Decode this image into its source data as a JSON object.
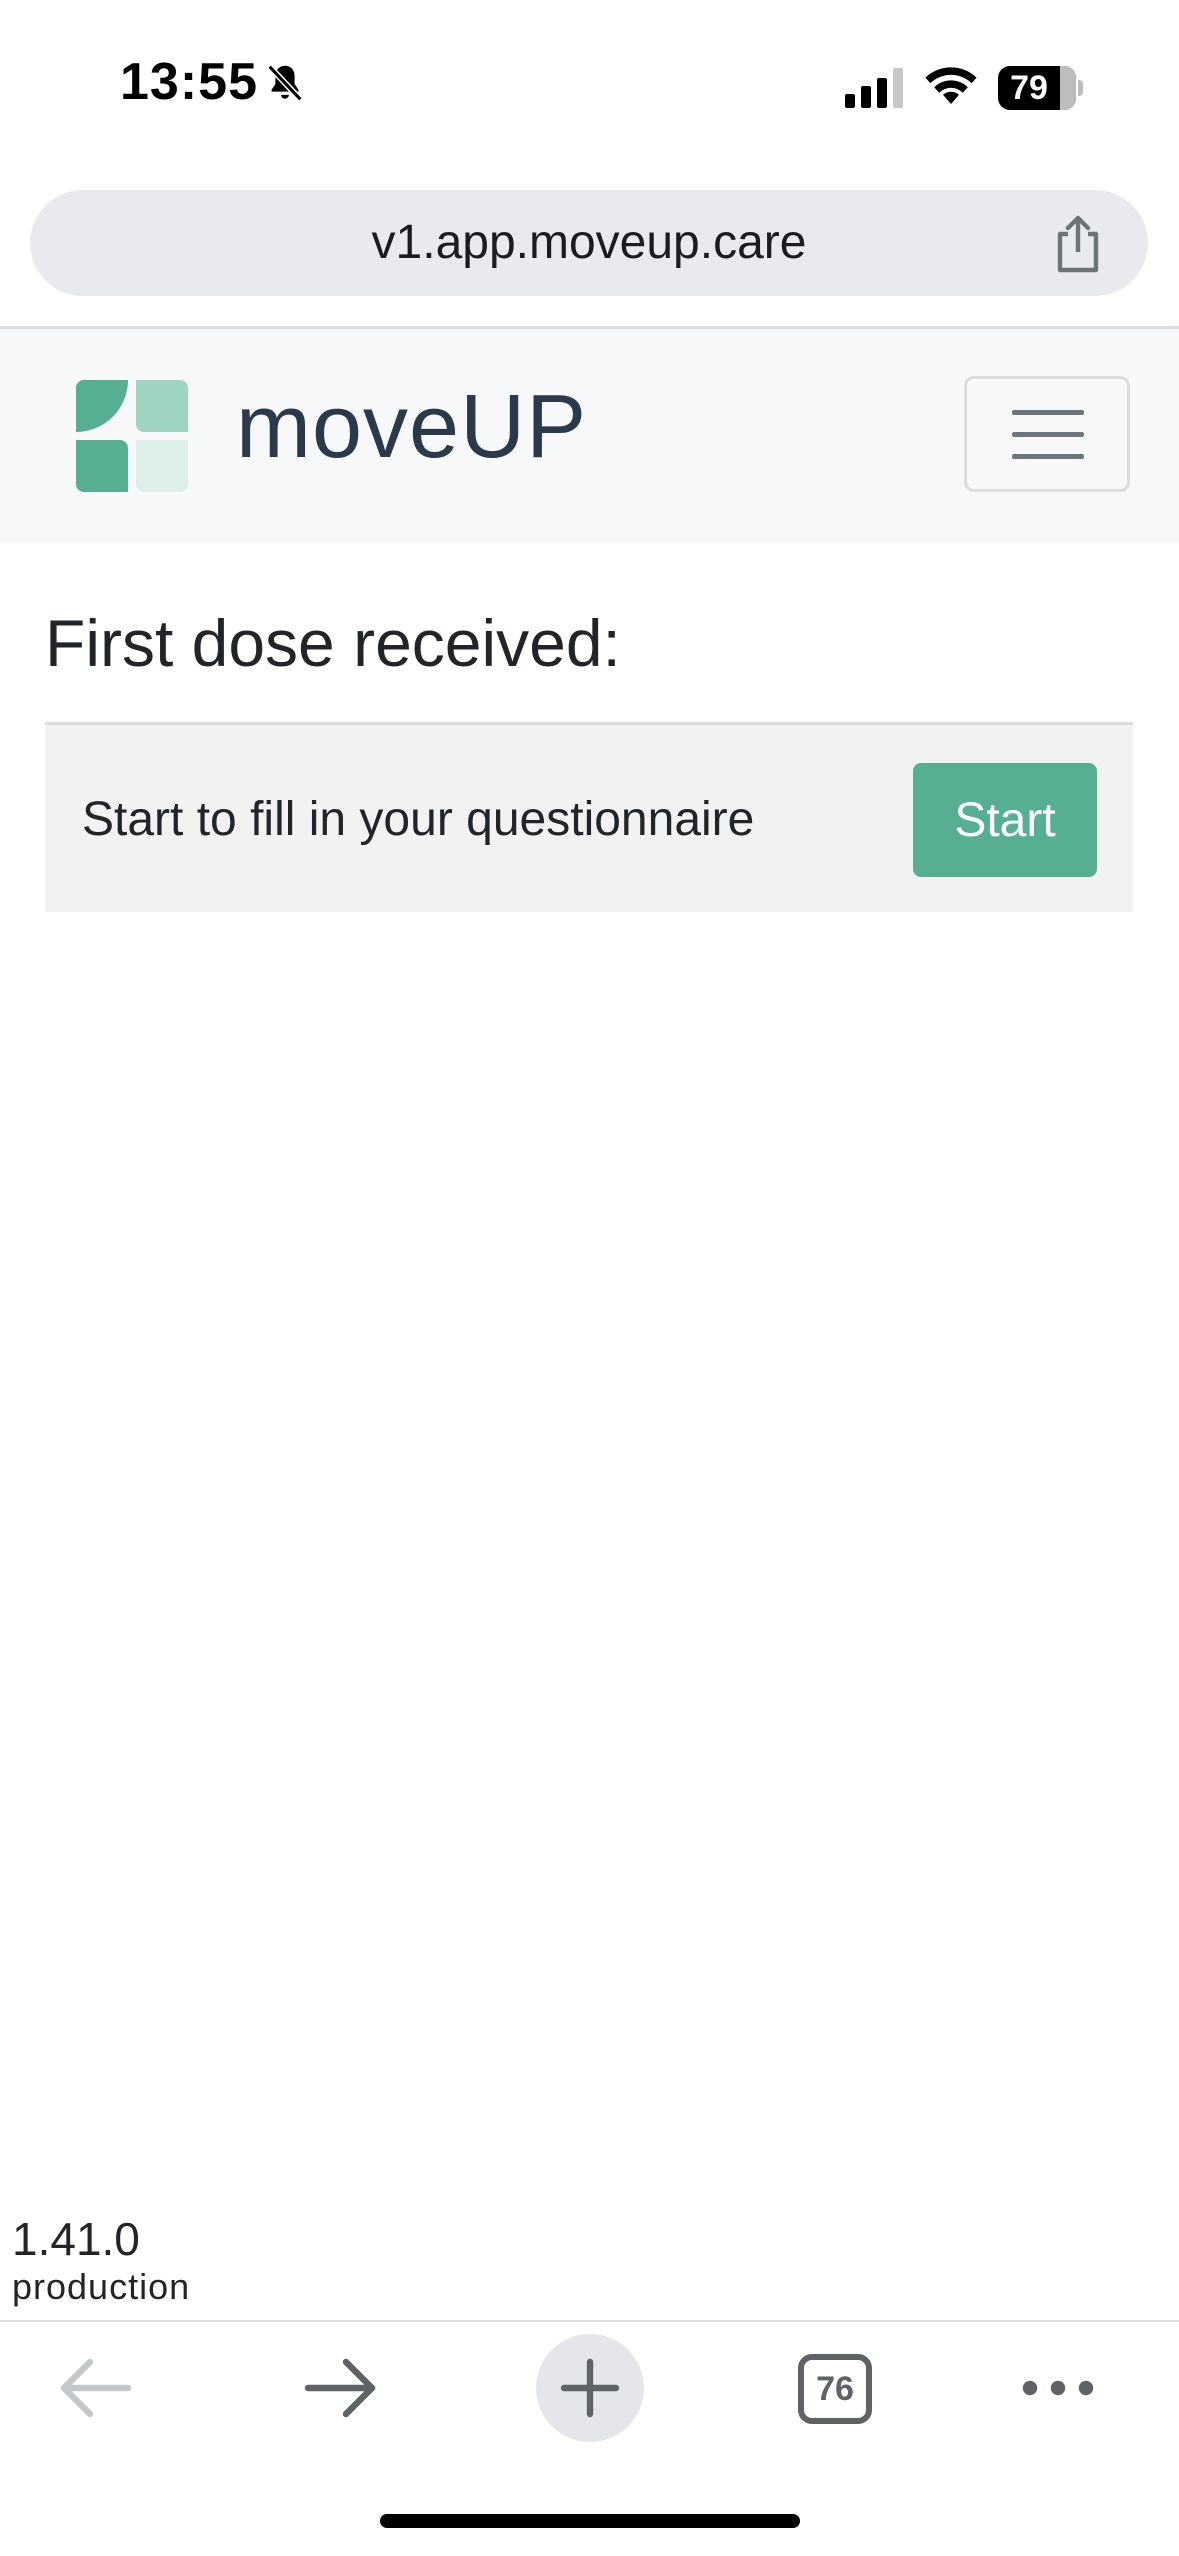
{
  "status_bar": {
    "time": "13:55",
    "battery_level": "79",
    "icons": [
      "bell-slash-icon",
      "cellular-signal-icon",
      "wifi-icon",
      "battery-icon"
    ]
  },
  "browser": {
    "url": "v1.app.moveup.care",
    "tabs_count": "76",
    "toolbar_icons": [
      "back-arrow-icon",
      "forward-arrow-icon",
      "plus-icon",
      "tabs-icon",
      "more-dots-icon"
    ]
  },
  "navbar": {
    "brand": "moveUP",
    "logo_colors": [
      "#56ae93",
      "#9fd3c2",
      "#56ae93",
      "#dcefe8"
    ]
  },
  "main": {
    "title": "First dose received:",
    "task": {
      "text": "Start to fill in your questionnaire",
      "button_label": "Start"
    }
  },
  "footer": {
    "version": "1.41.0",
    "environment": "production"
  },
  "colors": {
    "accent": "#56ae93",
    "brand_text": "#2b3a4a"
  }
}
